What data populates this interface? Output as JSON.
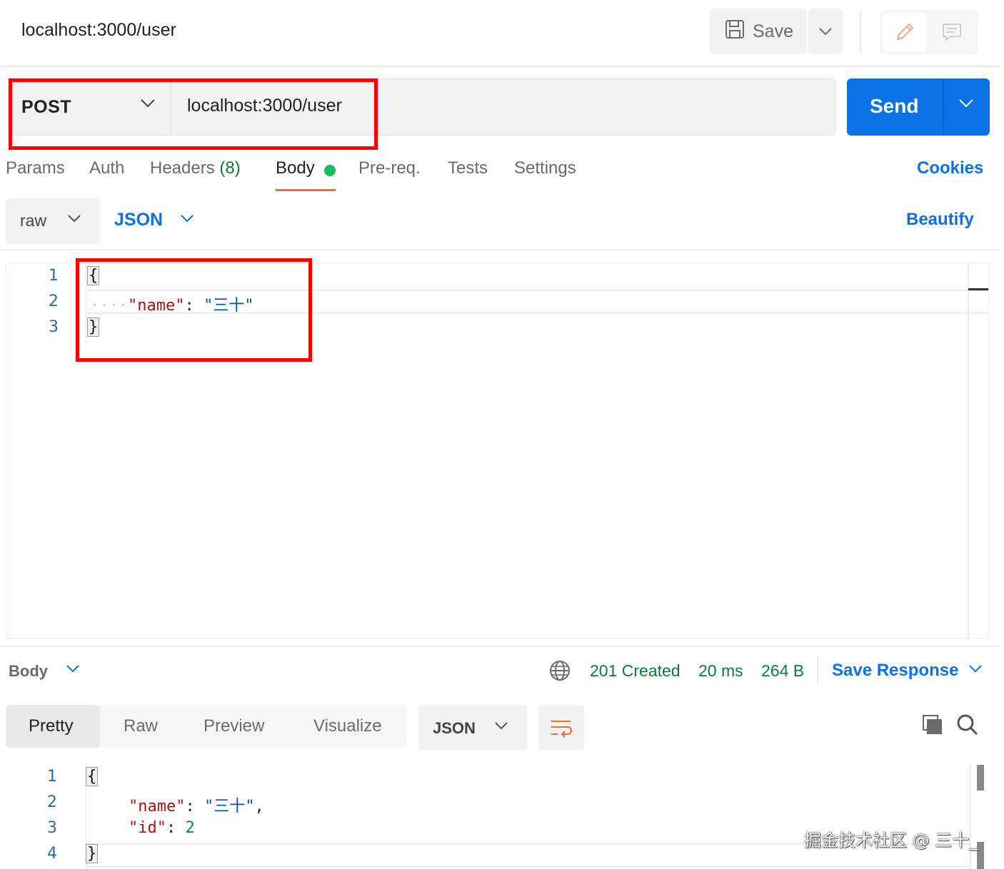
{
  "header": {
    "title": "localhost:3000/user",
    "save_label": "Save"
  },
  "request": {
    "method": "POST",
    "url": "localhost:3000/user",
    "send_label": "Send"
  },
  "tabs": {
    "params": "Params",
    "auth": "Auth",
    "headers": "Headers",
    "headers_count": "(8)",
    "body": "Body",
    "prereq": "Pre-req.",
    "tests": "Tests",
    "settings": "Settings",
    "cookies": "Cookies"
  },
  "body_mode": {
    "mode": "raw",
    "format": "JSON",
    "beautify": "Beautify"
  },
  "editor": {
    "line_numbers": [
      "1",
      "2",
      "3"
    ],
    "open_brace": "{",
    "close_brace": "}",
    "indent_dots": "····",
    "key": "\"name\"",
    "colon": ": ",
    "value": "\"三十\""
  },
  "response": {
    "body_label": "Body",
    "status": "201 Created",
    "time": "20 ms",
    "size": "264 B",
    "save_response": "Save Response",
    "view_tabs": {
      "pretty": "Pretty",
      "raw": "Raw",
      "preview": "Preview",
      "visualize": "Visualize"
    },
    "format": "JSON",
    "line_numbers": [
      "1",
      "2",
      "3",
      "4"
    ],
    "open_brace": "{",
    "close_brace": "}",
    "key1": "\"name\"",
    "value1": "\"三十\"",
    "comma": ",",
    "key2": "\"id\"",
    "value2": "2",
    "colon": ": "
  },
  "watermark": "掘金技术社区 @ 三十_",
  "colors": {
    "accent_blue": "#0b72e6",
    "status_green": "#0e7a3e",
    "tab_underline": "#f26b3a",
    "highlight_red": "#ff0000"
  }
}
